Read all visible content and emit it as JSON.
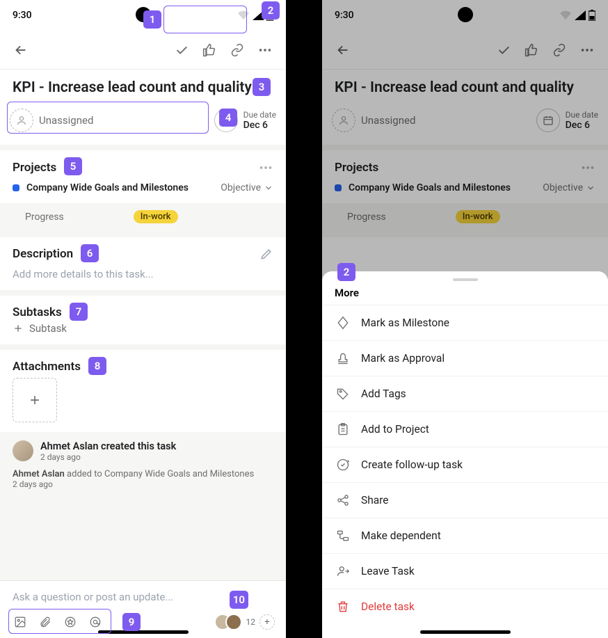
{
  "status": {
    "time": "9:30"
  },
  "task": {
    "title": "KPI - Increase lead count and quality",
    "assignee": "Unassigned",
    "due_label": "Due date",
    "due_value": "Dec 6"
  },
  "projects": {
    "header": "Projects",
    "name": "Company Wide Goals and Milestones",
    "status_label": "Objective",
    "progress_label": "Progress",
    "progress_badge": "In-work"
  },
  "description": {
    "header": "Description",
    "placeholder": "Add more details to this task..."
  },
  "subtasks": {
    "header": "Subtasks",
    "add_label": "Subtask"
  },
  "attachments": {
    "header": "Attachments"
  },
  "activity": {
    "created_by": "Ahmet Aslan created this task",
    "created_ago": "2 days ago",
    "added_by_name": "Ahmet Aslan",
    "added_text": " added to Company Wide Goals and Milestones",
    "added_ago": "2 days ago"
  },
  "composer": {
    "placeholder": "Ask a question or post an update...",
    "collaborator_count": "12"
  },
  "sheet": {
    "title": "More",
    "items": [
      "Mark as Milestone",
      "Mark as Approval",
      "Add Tags",
      "Add to Project",
      "Create follow-up task",
      "Share",
      "Make dependent",
      "Leave Task",
      "Delete task"
    ]
  },
  "callouts": {
    "c1": "1",
    "c2": "2",
    "c3": "3",
    "c4": "4",
    "c5": "5",
    "c6": "6",
    "c7": "7",
    "c8": "8",
    "c9": "9",
    "c10": "10"
  }
}
